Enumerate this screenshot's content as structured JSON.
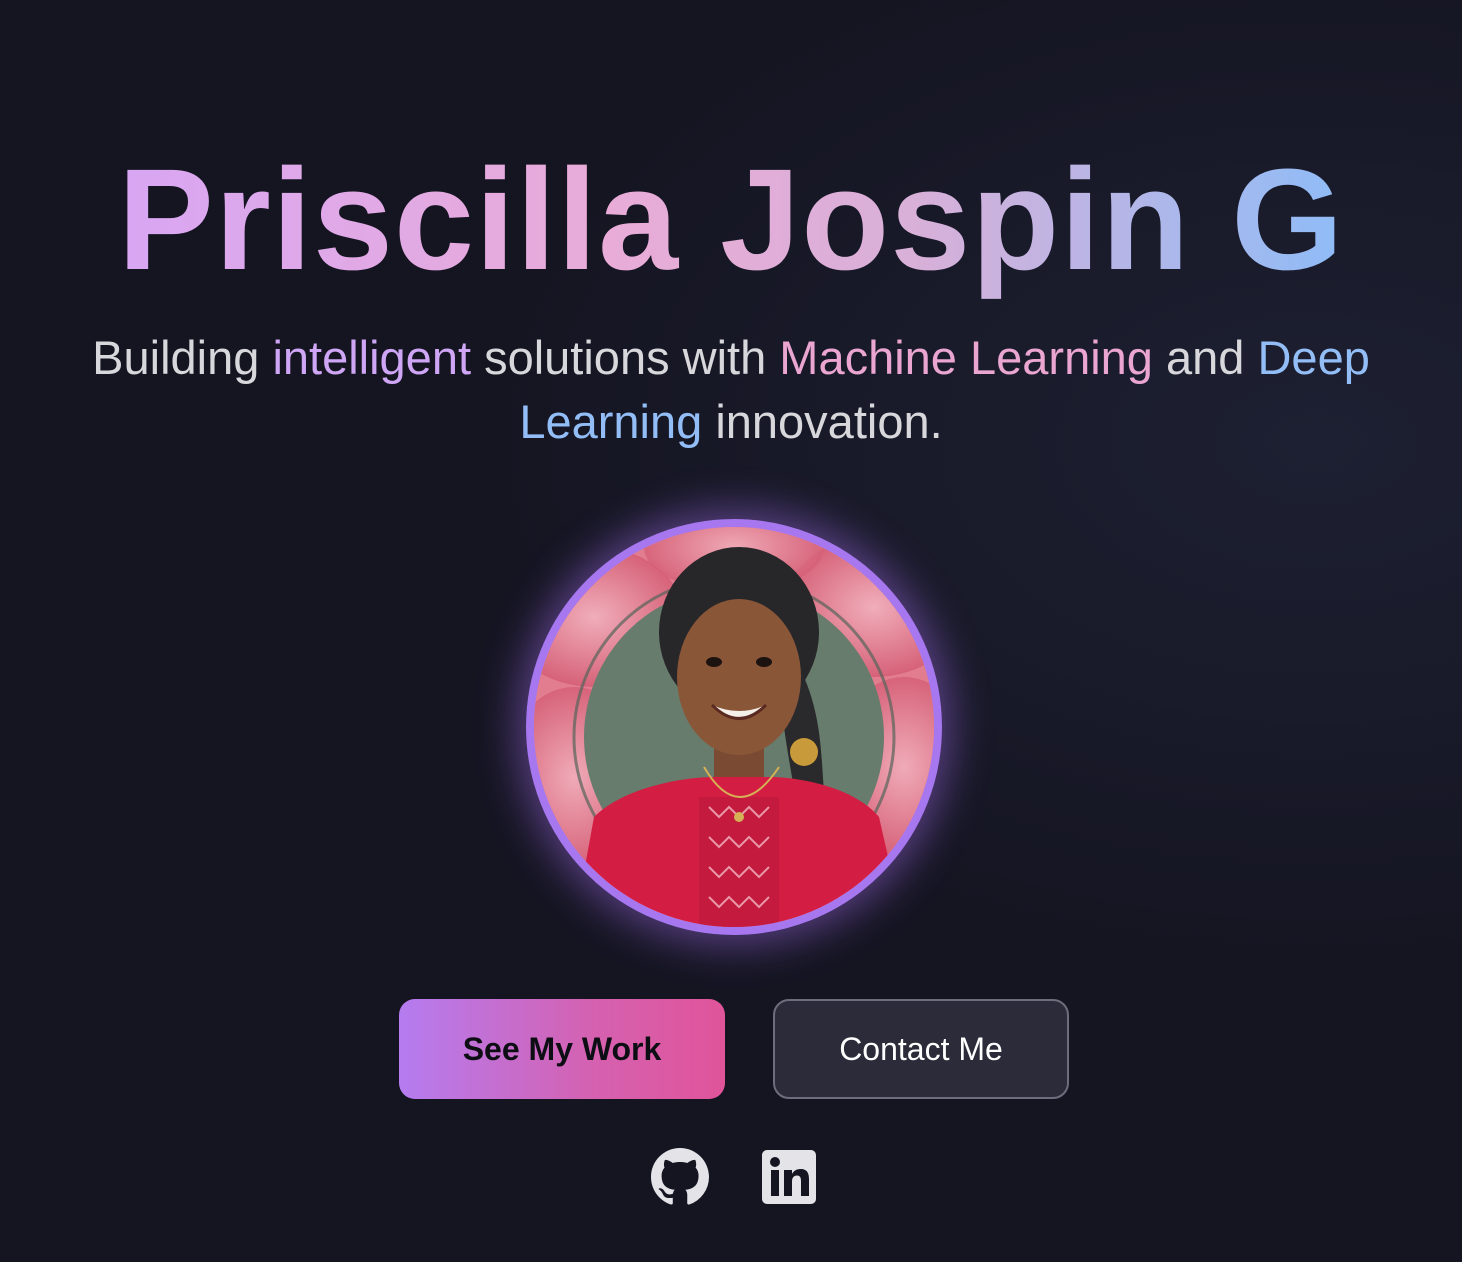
{
  "hero": {
    "name": "Priscilla Jospin G",
    "tagline": {
      "part1": "Building ",
      "highlight1": "intelligent",
      "part2": " solutions with ",
      "highlight2": "Machine Learning",
      "part3": " and ",
      "highlight3": "Deep Learning",
      "part4": " innovation."
    },
    "avatar_alt": "Profile photo"
  },
  "buttons": {
    "primary_label": "See My Work",
    "secondary_label": "Contact Me"
  },
  "social": [
    {
      "icon": "github-icon"
    },
    {
      "icon": "linkedin-icon"
    }
  ],
  "colors": {
    "background": "#151522",
    "accent_purple": "#a777f0",
    "accent_pink": "#e0549a",
    "highlight_blue": "#93bdf6"
  }
}
